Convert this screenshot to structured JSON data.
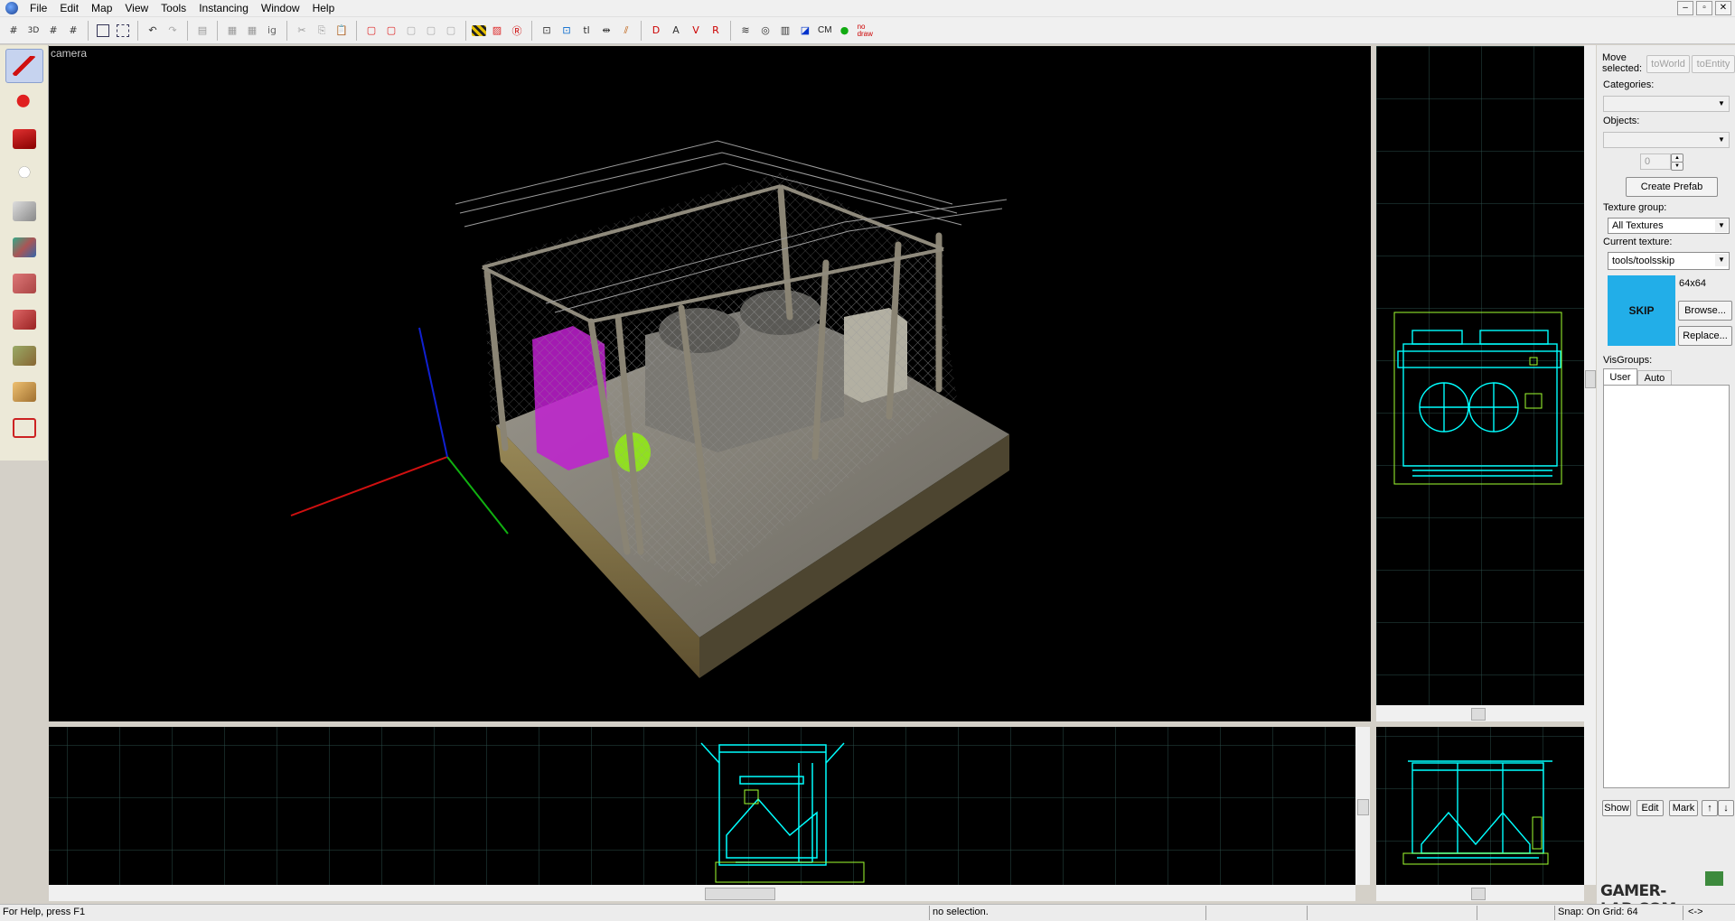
{
  "menu": [
    "File",
    "Edit",
    "Map",
    "View",
    "Tools",
    "Instancing",
    "Window",
    "Help"
  ],
  "window_buttons": [
    "‒",
    "▫",
    "✕"
  ],
  "toolbar": {
    "cm_label": "CM",
    "nodraw_label": "no draw"
  },
  "viewports": {
    "camera_label": "camera"
  },
  "right_panel": {
    "move_selected": "Move selected:",
    "to_world": "toWorld",
    "to_entity": "toEntity",
    "categories_label": "Categories:",
    "objects_label": "Objects:",
    "count_value": "0",
    "create_prefab": "Create Prefab",
    "texture_group_label": "Texture group:",
    "texture_group_value": "All Textures",
    "current_texture_label": "Current texture:",
    "current_texture_value": "tools/toolsskip",
    "texture_size": "64x64",
    "texture_preview_text": "SKIP",
    "texture_color": "#22aee8",
    "browse": "Browse...",
    "replace": "Replace...",
    "visgroups_label": "VisGroups:",
    "tab_user": "User",
    "tab_auto": "Auto",
    "show": "Show",
    "edit": "Edit",
    "mark": "Mark",
    "up": "↑",
    "down": "↓"
  },
  "status": {
    "help": "For Help, press F1",
    "selection": "no selection.",
    "snap": "Snap: On Grid: 64",
    "arrows": "<->"
  },
  "watermark": "GAMER-LAB.COM",
  "colors": {
    "wire": "#00ffff",
    "grid": "#2a4d49",
    "selected": "#a0ff30",
    "accent_active": "#c6d3ef"
  },
  "left_tools": [
    "selection-tool-icon",
    "magnify-tool-icon",
    "camera-tool-icon",
    "entity-tool-icon",
    "block-tool-icon",
    "texture-application-icon",
    "apply-texture-icon",
    "decal-tool-icon",
    "overlay-tool-icon",
    "clipping-tool-icon",
    "vertex-tool-icon"
  ]
}
